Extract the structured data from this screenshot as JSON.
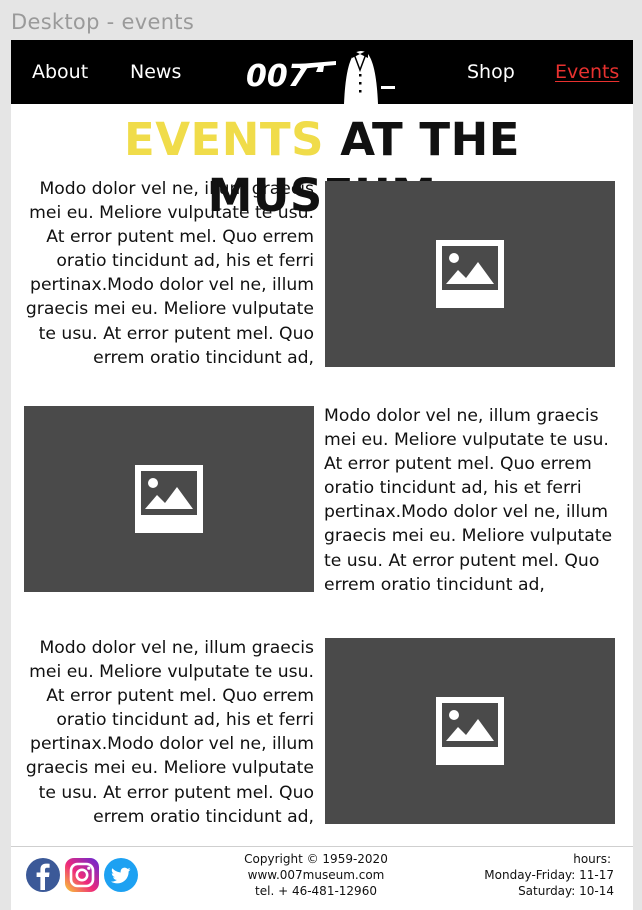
{
  "frame": {
    "title": "Desktop - events"
  },
  "nav": {
    "left_links": [
      "About",
      "News"
    ],
    "right_links": [
      "Shop",
      "Events"
    ],
    "active": "Events",
    "logo_text": "007"
  },
  "heading": {
    "accent": "EVENTS",
    "rest": " AT THE MUSEUM"
  },
  "events": [
    {
      "text": "Modo dolor vel ne, illum graecis mei eu. Meliore vulputate te usu. At error putent mel. Quo errem oratio tincidunt ad, his et ferri pertinax.Modo dolor vel ne, illum graecis mei eu. Meliore vulputate te usu. At error putent mel. Quo errem oratio tincidunt ad,"
    },
    {
      "text": "Modo dolor vel ne, illum graecis mei eu. Meliore vulputate te usu. At error putent mel. Quo errem oratio tincidunt ad, his et ferri pertinax.Modo dolor vel ne, illum graecis mei eu. Meliore vulputate te usu. At error putent mel. Quo errem oratio tincidunt ad,"
    },
    {
      "text": "Modo dolor vel ne, illum graecis mei eu. Meliore vulputate te usu. At error putent mel. Quo errem oratio tincidunt ad, his et ferri pertinax.Modo dolor vel ne, illum graecis mei eu. Meliore vulputate te usu. At error putent mel. Quo errem oratio tincidunt ad,"
    }
  ],
  "footer": {
    "social": [
      "facebook-icon",
      "instagram-icon",
      "twitter-icon"
    ],
    "copyright": "Copyright © 1959-2020",
    "website": "www.007museum.com",
    "phone": "tel. + 46-481-12960",
    "hours_label": "hours:",
    "hours_weekday": "Monday-Friday: 11-17",
    "hours_saturday": "Saturday: 10-14"
  },
  "colors": {
    "nav_bg": "#000000",
    "accent_yellow": "#f0dc4a",
    "active_red": "#e8312f",
    "placeholder": "#4a4a4a",
    "facebook": "#3b5998",
    "twitter": "#1da1f2"
  }
}
